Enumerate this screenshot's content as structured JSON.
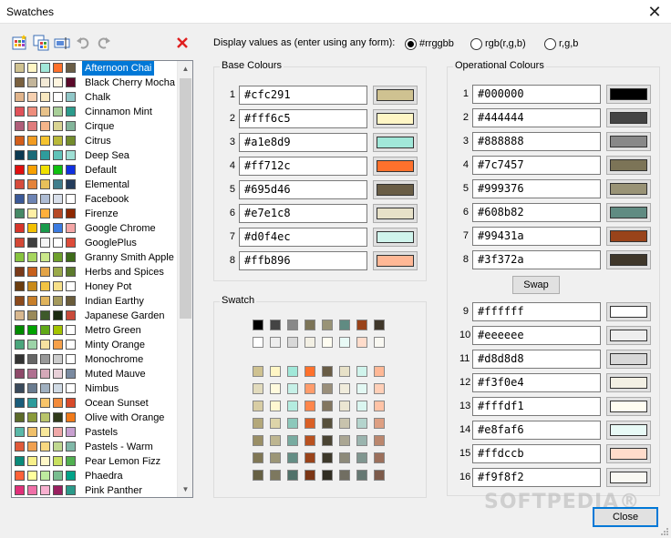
{
  "window": {
    "title": "Swatches",
    "close_glyph": "✕"
  },
  "toolbar": {
    "icons": [
      "new-swatch-icon",
      "copy-swatch-icon",
      "rename-swatch-icon",
      "undo-icon",
      "redo-icon",
      "delete-icon"
    ]
  },
  "display": {
    "label": "Display values as (enter using any form):",
    "options": [
      {
        "label": "#rrggbb",
        "selected": true
      },
      {
        "label": "rgb(r,g,b)",
        "selected": false
      },
      {
        "label": "r,g,b",
        "selected": false
      }
    ]
  },
  "swatch_list": {
    "selected_index": 0,
    "items": [
      {
        "name": "Afternoon Chai",
        "colors": [
          "#cfc291",
          "#fff6c5",
          "#a1e8d9",
          "#ff712c",
          "#695d46"
        ]
      },
      {
        "name": "Black Cherry Mocha",
        "colors": [
          "#7a6140",
          "#c3b59a",
          "#f2e9d5",
          "#fff6e0",
          "#5b0a2a"
        ]
      },
      {
        "name": "Chalk",
        "colors": [
          "#e0b48c",
          "#f6d0b0",
          "#f8e8c0",
          "#fefefe",
          "#90c7c8"
        ]
      },
      {
        "name": "Cinnamon Mint",
        "colors": [
          "#e0525a",
          "#ef8d7c",
          "#e8c28a",
          "#a8cf98",
          "#2b9b8c"
        ]
      },
      {
        "name": "Cirque",
        "colors": [
          "#b05f7a",
          "#e07c7c",
          "#f5b58a",
          "#d9d492",
          "#83b59a"
        ]
      },
      {
        "name": "Citrus",
        "colors": [
          "#d25e1b",
          "#f29c22",
          "#f5c32f",
          "#b9b93a",
          "#738c2c"
        ]
      },
      {
        "name": "Deep Sea",
        "colors": [
          "#0d3a52",
          "#1c6b78",
          "#2e9c9c",
          "#60c3b8",
          "#9fe0d5"
        ]
      },
      {
        "name": "Default",
        "colors": [
          "#e01010",
          "#f8a000",
          "#f0e000",
          "#10c010",
          "#1030e0"
        ]
      },
      {
        "name": "Elemental",
        "colors": [
          "#d64b3b",
          "#e4833b",
          "#e8c05a",
          "#3f7d8c",
          "#233c5c"
        ]
      },
      {
        "name": "Facebook",
        "colors": [
          "#3b5998",
          "#6d84b4",
          "#afbdd4",
          "#d8dfea",
          "#ffffff"
        ]
      },
      {
        "name": "Firenze",
        "colors": [
          "#468966",
          "#fff0a5",
          "#ffb03b",
          "#b64926",
          "#8e2800"
        ]
      },
      {
        "name": "Google Chrome",
        "colors": [
          "#d7352b",
          "#f3c000",
          "#1a9b4b",
          "#3b7be0",
          "#f4a6a6"
        ]
      },
      {
        "name": "GooglePlus",
        "colors": [
          "#d34836",
          "#404040",
          "#f5f5f5",
          "#ffffff",
          "#dd4b39"
        ]
      },
      {
        "name": "Granny Smith Apple",
        "colors": [
          "#87c33f",
          "#a7d65f",
          "#cbe88a",
          "#6ea02c",
          "#3e6b1a"
        ]
      },
      {
        "name": "Herbs and Spices",
        "colors": [
          "#7a3a1a",
          "#c7601c",
          "#e3a447",
          "#9aaa4a",
          "#5c7a2c"
        ]
      },
      {
        "name": "Honey Pot",
        "colors": [
          "#6b3d10",
          "#c98a1a",
          "#f2c443",
          "#f7e08a",
          "#ffffff"
        ]
      },
      {
        "name": "Indian Earthy",
        "colors": [
          "#8c4a1c",
          "#c87f2a",
          "#e0b45c",
          "#a59a5c",
          "#6a5c3a"
        ]
      },
      {
        "name": "Japanese Garden",
        "colors": [
          "#d8b890",
          "#9a8a5a",
          "#3e5a2a",
          "#1a2a10",
          "#c94a3a"
        ]
      },
      {
        "name": "Metro Green",
        "colors": [
          "#008a00",
          "#00a300",
          "#60a917",
          "#a4c400",
          "#ffffff"
        ]
      },
      {
        "name": "Minty Orange",
        "colors": [
          "#4aa57c",
          "#9cd4a8",
          "#f7e2a0",
          "#f5a04a",
          "#ffffff"
        ]
      },
      {
        "name": "Monochrome",
        "colors": [
          "#333333",
          "#666666",
          "#999999",
          "#cccccc",
          "#ffffff"
        ]
      },
      {
        "name": "Muted Mauve",
        "colors": [
          "#8e4a6a",
          "#b07090",
          "#d4a8b8",
          "#e8d0d8",
          "#7a8aa0"
        ]
      },
      {
        "name": "Nimbus",
        "colors": [
          "#3a4a5c",
          "#6a7c90",
          "#a0b0c0",
          "#d0dae4",
          "#ffffff"
        ]
      },
      {
        "name": "Ocean Sunset",
        "colors": [
          "#1a5c7a",
          "#2e9c9c",
          "#f7c46a",
          "#f28a3a",
          "#d84a2a"
        ]
      },
      {
        "name": "Olive with Orange",
        "colors": [
          "#5c6a2a",
          "#8a9a3a",
          "#b8c46a",
          "#303a1a",
          "#f07a1a"
        ]
      },
      {
        "name": "Pastels",
        "colors": [
          "#5ab8a8",
          "#f0c06a",
          "#f8e89a",
          "#f0a8a8",
          "#c8a0d0"
        ]
      },
      {
        "name": "Pastels - Warm",
        "colors": [
          "#e05a3a",
          "#f0a050",
          "#f8d880",
          "#c0d890",
          "#80b8a8"
        ]
      },
      {
        "name": "Pear Lemon Fizz",
        "colors": [
          "#0a8a7a",
          "#f8f08a",
          "#fff8c8",
          "#c8e060",
          "#50b050"
        ]
      },
      {
        "name": "Phaedra",
        "colors": [
          "#ff6138",
          "#ffff9d",
          "#beeb9f",
          "#79bd8f",
          "#00a388"
        ]
      },
      {
        "name": "Pink Panther",
        "colors": [
          "#e0307a",
          "#f070a8",
          "#f8b0d0",
          "#9a2060",
          "#2a9a8a"
        ]
      }
    ]
  },
  "base_colours": {
    "title": "Base Colours",
    "rows": [
      {
        "num": "1",
        "hex": "#cfc291",
        "color": "#cfc291"
      },
      {
        "num": "2",
        "hex": "#fff6c5",
        "color": "#fff6c5"
      },
      {
        "num": "3",
        "hex": "#a1e8d9",
        "color": "#a1e8d9"
      },
      {
        "num": "4",
        "hex": "#ff712c",
        "color": "#ff712c"
      },
      {
        "num": "5",
        "hex": "#695d46",
        "color": "#695d46"
      },
      {
        "num": "6",
        "hex": "#e7e1c8",
        "color": "#e7e1c8"
      },
      {
        "num": "7",
        "hex": "#d0f4ec",
        "color": "#d0f4ec"
      },
      {
        "num": "8",
        "hex": "#ffb896",
        "color": "#ffb896"
      }
    ]
  },
  "operational_colours": {
    "title": "Operational Colours",
    "swap_label": "Swap",
    "rows_top": [
      {
        "num": "1",
        "hex": "#000000",
        "color": "#000000"
      },
      {
        "num": "2",
        "hex": "#444444",
        "color": "#444444"
      },
      {
        "num": "3",
        "hex": "#888888",
        "color": "#888888"
      },
      {
        "num": "4",
        "hex": "#7c7457",
        "color": "#7c7457"
      },
      {
        "num": "5",
        "hex": "#999376",
        "color": "#999376"
      },
      {
        "num": "6",
        "hex": "#608b82",
        "color": "#608b82"
      },
      {
        "num": "7",
        "hex": "#99431a",
        "color": "#99431a"
      },
      {
        "num": "8",
        "hex": "#3f372a",
        "color": "#3f372a"
      }
    ],
    "rows_bottom": [
      {
        "num": "9",
        "hex": "#ffffff",
        "color": "#ffffff"
      },
      {
        "num": "10",
        "hex": "#eeeeee",
        "color": "#eeeeee"
      },
      {
        "num": "11",
        "hex": "#d8d8d8",
        "color": "#d8d8d8"
      },
      {
        "num": "12",
        "hex": "#f3f0e4",
        "color": "#f3f0e4"
      },
      {
        "num": "13",
        "hex": "#fffdf1",
        "color": "#fffdf1"
      },
      {
        "num": "14",
        "hex": "#e8faf6",
        "color": "#e8faf6"
      },
      {
        "num": "15",
        "hex": "#ffdccb",
        "color": "#ffdccb"
      },
      {
        "num": "16",
        "hex": "#f9f8f2",
        "color": "#f9f8f2"
      }
    ]
  },
  "swatch_preview": {
    "title": "Swatch",
    "top_rows": [
      [
        "#000000",
        "#444444",
        "#888888",
        "#7c7457",
        "#999376",
        "#608b82",
        "#99431a",
        "#3f372a"
      ],
      [
        "#ffffff",
        "#eeeeee",
        "#d8d8d8",
        "#f3f0e4",
        "#fffdf1",
        "#e8faf6",
        "#ffdccb",
        "#f9f8f2"
      ]
    ],
    "grid_rows": [
      [
        "#cfc291",
        "#fff6c5",
        "#a1e8d9",
        "#ff712c",
        "#695d46",
        "#e7e1c8",
        "#d0f4ec",
        "#ffb896"
      ],
      [
        "#e2dbbd",
        "#fffadd",
        "#c6f0e7",
        "#ff9c6b",
        "#9a8f7a",
        "#f0ecdc",
        "#e3f8f3",
        "#ffcfb7"
      ],
      [
        "#d8cda4",
        "#fff8d1",
        "#b4ece0",
        "#ff864b",
        "#827660",
        "#ebe6d2",
        "#daf6f0",
        "#ffc3a6"
      ],
      [
        "#b4a87a",
        "#ddd4a9",
        "#8cc8bb",
        "#d95f25",
        "#57503c",
        "#c8c3ad",
        "#b4d4cd",
        "#dd9f82"
      ],
      [
        "#9a8f66",
        "#bdb590",
        "#78aba0",
        "#b9511f",
        "#4a4433",
        "#aaa693",
        "#9ab4ae",
        "#bb876e"
      ],
      [
        "#807755",
        "#9c9677",
        "#648e85",
        "#9a431a",
        "#3d382a",
        "#8d8a7a",
        "#809690",
        "#9c705c"
      ],
      [
        "#666044",
        "#7d785f",
        "#50716a",
        "#7b3615",
        "#302d22",
        "#716e62",
        "#667873",
        "#7c5a4a"
      ]
    ]
  }
}
